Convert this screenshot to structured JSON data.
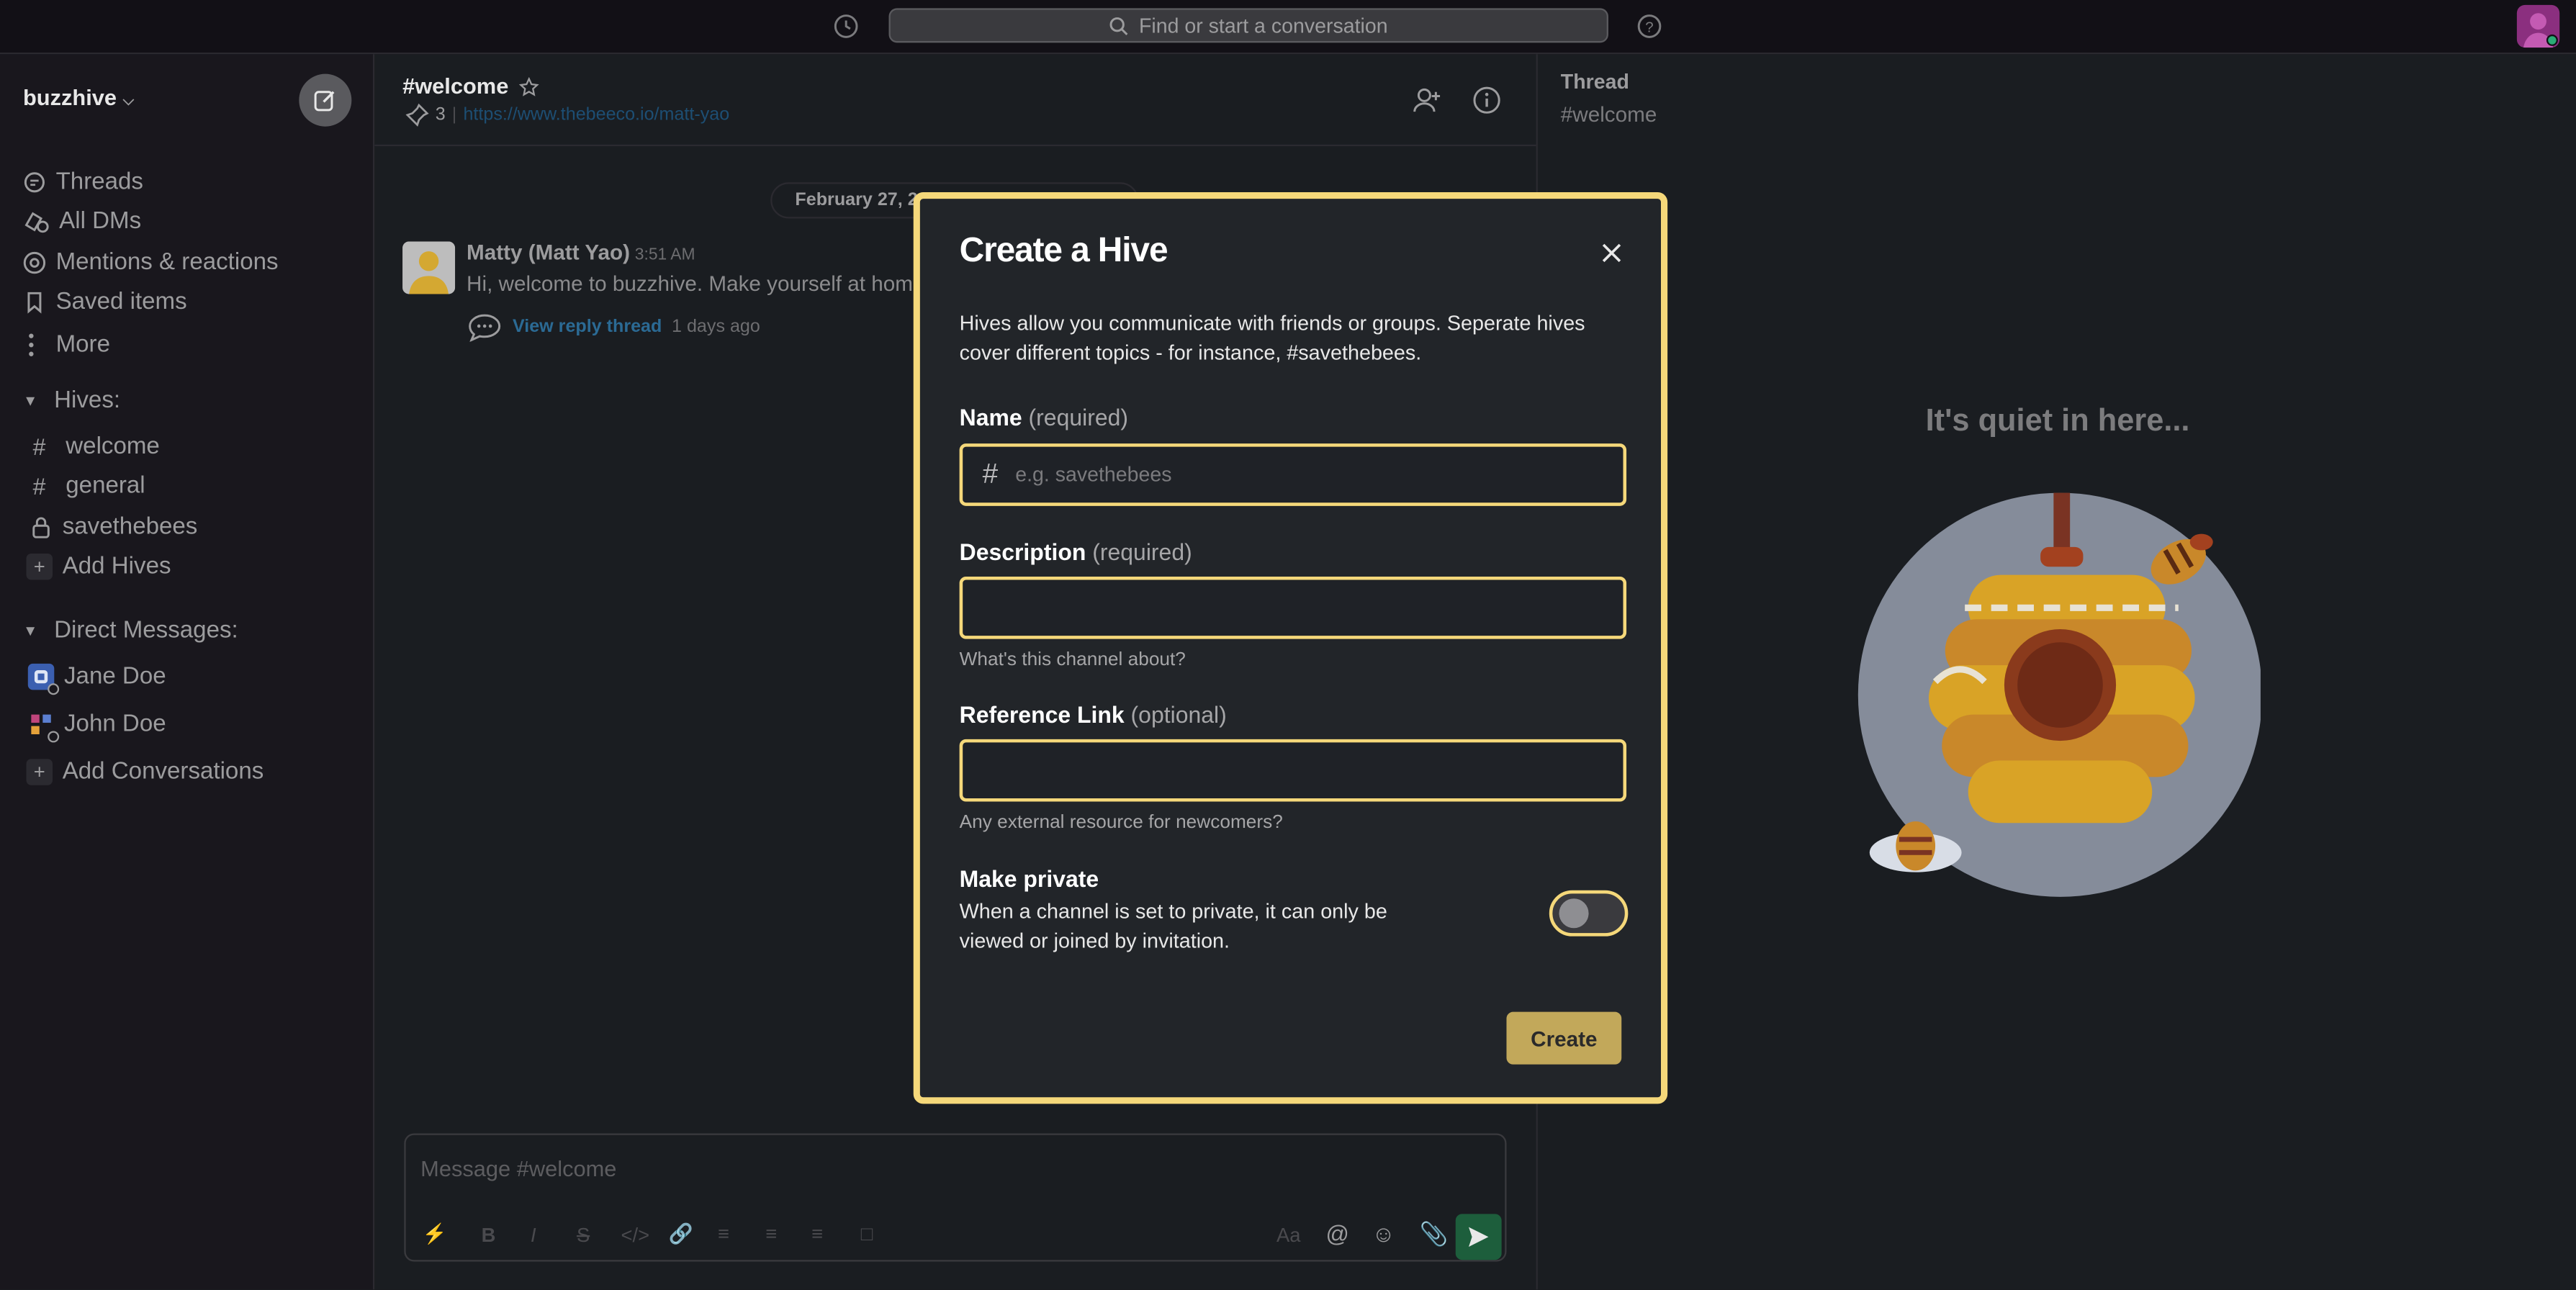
{
  "topbar": {
    "search_placeholder": "Find or start a conversation"
  },
  "sidebar": {
    "workspace_name": "buzzhive",
    "nav": [
      {
        "label": "Threads",
        "icon": "threads-icon"
      },
      {
        "label": "All DMs",
        "icon": "dms-icon"
      },
      {
        "label": "Mentions & reactions",
        "icon": "at-icon"
      },
      {
        "label": "Saved items",
        "icon": "bookmark-icon"
      },
      {
        "label": "More",
        "icon": "more-icon"
      }
    ],
    "hives_header": "Hives:",
    "hives": [
      {
        "label": "welcome",
        "icon": "hash-icon"
      },
      {
        "label": "general",
        "icon": "hash-icon"
      },
      {
        "label": "savethebees",
        "icon": "lock-icon"
      }
    ],
    "add_hives": "Add Hives",
    "dm_header": "Direct Messages:",
    "dms": [
      {
        "label": "Jane Doe"
      },
      {
        "label": "John Doe"
      }
    ],
    "add_conversations": "Add Conversations"
  },
  "channel": {
    "name": "#welcome",
    "pinned_count": "3",
    "topic_link": "https://www.thebeeco.io/matt-yao",
    "date_divider": "February 27, 2023",
    "message": {
      "author": "Matty (Matt Yao)",
      "time": "3:51 AM",
      "text": "Hi, welcome to buzzhive. Make yourself at home!",
      "reply_label": "View reply thread",
      "reply_ago": "1 days ago"
    },
    "composer_placeholder": "Message #welcome",
    "composer_format_label": "Aa"
  },
  "thread": {
    "title": "Thread",
    "channel": "#welcome",
    "empty_text": "It's quiet in here..."
  },
  "modal": {
    "title": "Create a Hive",
    "description": "Hives allow you communicate with friends or groups. Seperate hives cover different topics - for instance, #savethebees.",
    "name_label": "Name",
    "name_suffix": "(required)",
    "name_prefix": "#",
    "name_placeholder": "e.g. savethebees",
    "desc_label": "Description",
    "desc_suffix": "(required)",
    "desc_hint": "What's this channel about?",
    "link_label": "Reference Link",
    "link_suffix": "(optional)",
    "link_hint": "Any external resource for newcomers?",
    "private_title": "Make private",
    "private_text": "When a channel is set to private, it can only be viewed or joined by invitation.",
    "private_enabled": false,
    "create_label": "Create"
  },
  "colors": {
    "accent": "#f5d87a",
    "create_button": "#c2a85a",
    "send_button": "#1d5e3c"
  }
}
